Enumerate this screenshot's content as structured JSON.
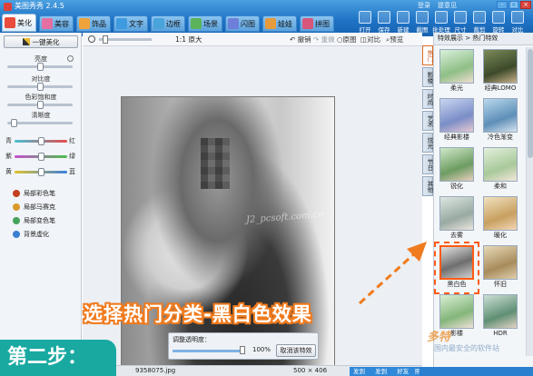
{
  "app": {
    "title": "美图秀秀 2.4.5",
    "account": [
      "登录",
      "提意见"
    ],
    "win_buttons": [
      "-",
      "□",
      "×"
    ]
  },
  "tabs": [
    {
      "label": "美化",
      "icon": "beautify-icon",
      "color": "#e94b3c",
      "active": true
    },
    {
      "label": "美容",
      "icon": "face-icon",
      "color": "#e46fa0"
    },
    {
      "label": "饰品",
      "icon": "ornament-icon",
      "color": "#f0a33a"
    },
    {
      "label": "文字",
      "icon": "text-icon",
      "color": "#3f9be0"
    },
    {
      "label": "边框",
      "icon": "frame-icon",
      "color": "#4aa3da"
    },
    {
      "label": "场景",
      "icon": "scene-icon",
      "color": "#5bb35a"
    },
    {
      "label": "闪图",
      "icon": "flash-icon",
      "color": "#6d7fd8"
    },
    {
      "label": "娃娃",
      "icon": "doll-icon",
      "color": "#e59a3b"
    },
    {
      "label": "拼图",
      "icon": "puzzle-icon",
      "color": "#d8567a"
    }
  ],
  "toolbar": [
    "打开",
    "保存",
    "新建",
    "截图",
    "批处理",
    "尺寸",
    "裁剪",
    "旋转",
    "对比"
  ],
  "left": {
    "beauty_button": "一键美化",
    "adjust": [
      "亮度",
      "对比度",
      "色彩饱和度",
      "清晰度"
    ],
    "balance": [
      [
        "青",
        "红"
      ],
      [
        "紫",
        "绿"
      ],
      [
        "黄",
        "蓝"
      ]
    ],
    "brushes": [
      {
        "label": "局部彩色笔",
        "color": "#c2401f"
      },
      {
        "label": "局部马赛克",
        "color": "#d99a2a"
      },
      {
        "label": "局部变色笔",
        "color": "#45a35b"
      },
      {
        "label": "背景虚化",
        "color": "#3b7fd0"
      }
    ]
  },
  "canvas": {
    "zoom_text": "1:1 原大",
    "actions": [
      "撤销",
      "重做",
      "原图",
      "对比",
      "预览"
    ],
    "watermark": "J2_pcsoft.com.cn",
    "opacity_label": "调整透明度：",
    "opacity_value": "100%",
    "cancel_effect": "取消该特效",
    "filename": "9358075",
    "filename_ext": ".jpg",
    "dims": "500 × 406"
  },
  "categories": [
    "热门",
    "影楼",
    "时尚",
    "艺术",
    "炫光",
    "节日",
    "其他"
  ],
  "effects": {
    "breadcrumb": "特效展示 > 热门特效",
    "items": [
      {
        "label": "柔光"
      },
      {
        "label": "经典LOMO"
      },
      {
        "label": "经典影楼"
      },
      {
        "label": "冷色渐变"
      },
      {
        "label": "锐化"
      },
      {
        "label": "柔和"
      },
      {
        "label": "去雾"
      },
      {
        "label": "暖化"
      },
      {
        "label": "黑白色",
        "selected": true
      },
      {
        "label": "怀旧"
      },
      {
        "label": "影楼"
      },
      {
        "label": "HDR"
      }
    ]
  },
  "overlay": {
    "callout": "选择热门分类-黑白色效果",
    "step": "第二步：",
    "arrow_color": "#f07b1e",
    "brand": "多特",
    "brand_sub": "国内最安全的软件站",
    "share": [
      "发到微博",
      "发到朋友",
      "好友热",
      "照片发网"
    ]
  }
}
